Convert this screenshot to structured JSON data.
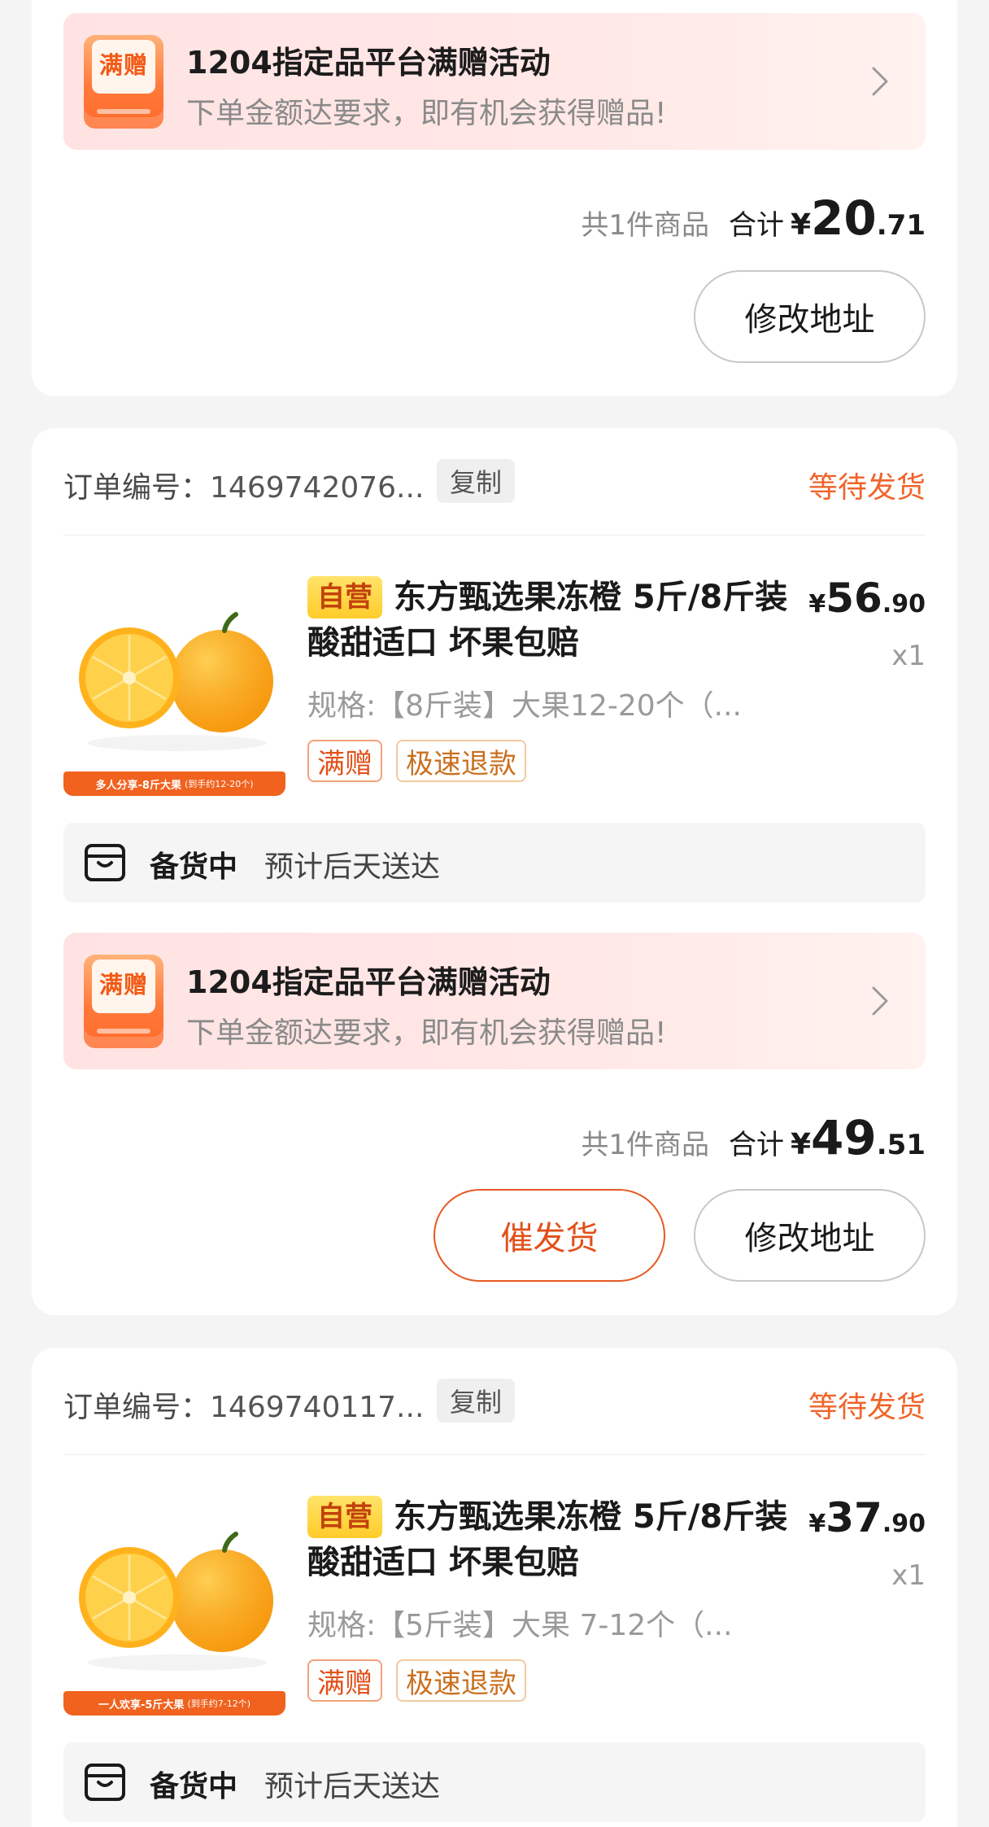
{
  "promo": {
    "badge": "满赠",
    "title": "1204指定品平台满赠活动",
    "subtitle": "下单金额达要求，即有机会获得赠品!"
  },
  "order0": {
    "count": "共1件商品",
    "sum_label": "合计",
    "yen": "¥",
    "total_int": "20",
    "total_dec": ".71",
    "modify_address": "修改地址"
  },
  "order1": {
    "order_no_label": "订单编号：",
    "order_no": "1469742076...",
    "copy": "复制",
    "status": "等待发货",
    "self_tag": "自营",
    "title": "东方甄选果冻橙 5斤/8斤装 酸甜适口 坏果包赔",
    "yen": "¥",
    "price_int": "56",
    "price_dec": ".90",
    "qty": "x1",
    "spec": "规格:【8斤装】大果12-20个（...",
    "tag1": "满赠",
    "tag2": "极速退款",
    "thumb_banner": "多人分享-8斤大果",
    "thumb_banner_sub": "(到手约12-20个)",
    "ship_status": "备货中",
    "ship_eta": "预计后天送达",
    "count": "共1件商品",
    "sum_label": "合计",
    "total_int": "49",
    "total_dec": ".51",
    "urge_ship": "催发货",
    "modify_address": "修改地址"
  },
  "order2": {
    "order_no_label": "订单编号：",
    "order_no": "1469740117...",
    "copy": "复制",
    "status": "等待发货",
    "self_tag": "自营",
    "title": "东方甄选果冻橙 5斤/8斤装 酸甜适口 坏果包赔",
    "yen": "¥",
    "price_int": "37",
    "price_dec": ".90",
    "qty": "x1",
    "spec": "规格:【5斤装】大果 7-12个（...",
    "tag1": "满赠",
    "tag2": "极速退款",
    "thumb_banner": "一人欢享-5斤大果",
    "thumb_banner_sub": "(到手约7-12个)",
    "ship_status": "备货中",
    "ship_eta": "预计后天送达"
  },
  "colors": {
    "accent_orange": "#f0642a",
    "background": "#f4f4f4",
    "promo_bg": "#ffe3e3"
  }
}
